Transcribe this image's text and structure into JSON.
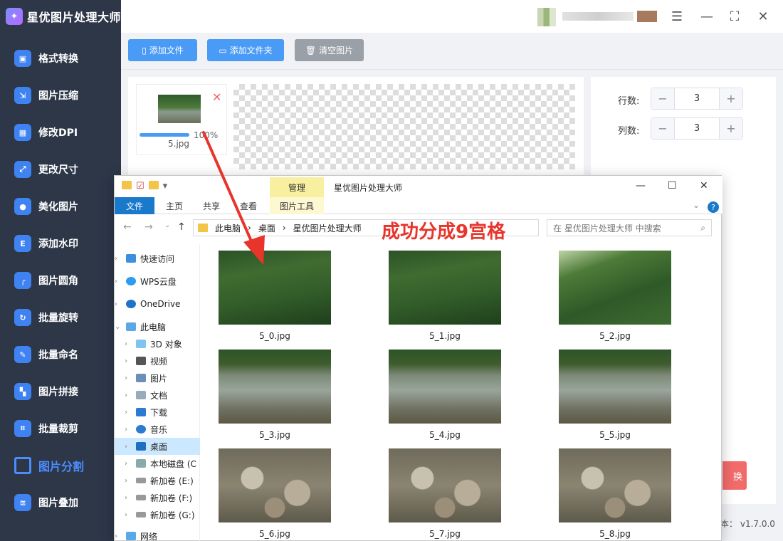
{
  "app": {
    "title": "星优图片处理大师",
    "version": "v1.7.0.0",
    "version_prefix": "本："
  },
  "sidebar": {
    "items": [
      {
        "label": "格式转换"
      },
      {
        "label": "图片压缩"
      },
      {
        "label": "修改DPI"
      },
      {
        "label": "更改尺寸"
      },
      {
        "label": "美化图片"
      },
      {
        "label": "添加水印"
      },
      {
        "label": "图片圆角"
      },
      {
        "label": "批量旋转"
      },
      {
        "label": "批量命名"
      },
      {
        "label": "图片拼接"
      },
      {
        "label": "批量裁剪"
      },
      {
        "label": "图片分割",
        "active": true
      },
      {
        "label": "图片叠加"
      }
    ]
  },
  "toolbar": {
    "add_file": "添加文件",
    "add_folder": "添加文件夹",
    "clear": "清空图片"
  },
  "filelist": {
    "filename": "5.jpg",
    "progress_label": "100%",
    "progress": 1.0
  },
  "settings": {
    "rows_label": "行数:",
    "rows_value": "3",
    "cols_label": "列数:",
    "cols_value": "3",
    "convert_label": "换"
  },
  "explorer": {
    "window_title": "星优图片处理大师",
    "manage_tab": "管理",
    "tabs": [
      "文件",
      "主页",
      "共享",
      "查看"
    ],
    "picture_tools_tab": "图片工具",
    "address": [
      "此电脑",
      "桌面",
      "星优图片处理大师"
    ],
    "search_placeholder": "在 星优图片处理大师 中搜索",
    "annotation": "成功分成9宫格",
    "nav": [
      {
        "label": "快速访问"
      },
      {
        "label": "WPS云盘"
      },
      {
        "label": "OneDrive"
      },
      {
        "label": "此电脑"
      },
      {
        "label": "3D 对象"
      },
      {
        "label": "视频"
      },
      {
        "label": "图片"
      },
      {
        "label": "文档"
      },
      {
        "label": "下载"
      },
      {
        "label": "音乐"
      },
      {
        "label": "桌面",
        "selected": true
      },
      {
        "label": "本地磁盘 (C"
      },
      {
        "label": "新加卷 (E:)"
      },
      {
        "label": "新加卷 (F:)"
      },
      {
        "label": "新加卷 (G:)"
      },
      {
        "label": "网络"
      }
    ],
    "files": [
      "5_0.jpg",
      "5_1.jpg",
      "5_2.jpg",
      "5_3.jpg",
      "5_4.jpg",
      "5_5.jpg",
      "5_6.jpg",
      "5_7.jpg",
      "5_8.jpg"
    ]
  },
  "colors": {
    "sidebar_bg": "#2d3748",
    "accent": "#4a9bf5",
    "active_nav": "#4b8cff",
    "annotation": "#e8342b",
    "convert": "#f26b6b"
  }
}
